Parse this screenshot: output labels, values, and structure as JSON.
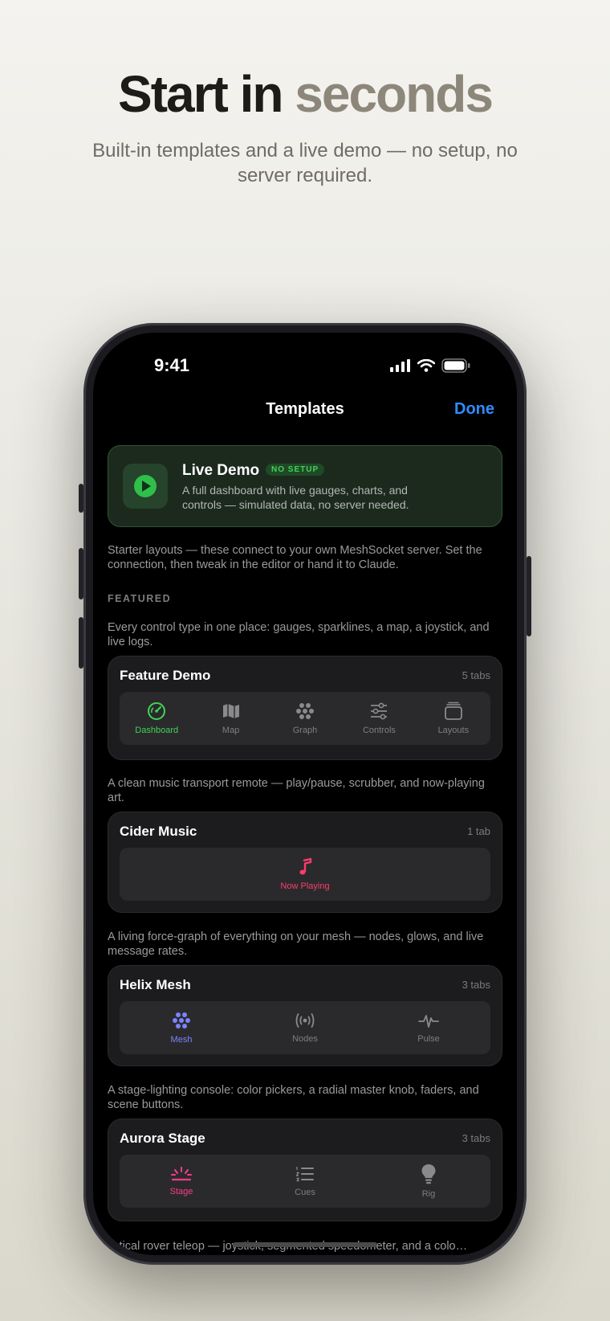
{
  "hero": {
    "title_main": "Start in",
    "title_accent": "seconds",
    "subtitle": "Built-in templates and a live demo — no setup, no server required."
  },
  "status_bar": {
    "time": "9:41"
  },
  "nav": {
    "title": "Templates",
    "done_label": "Done"
  },
  "live_demo": {
    "title": "Live Demo",
    "badge": "NO SETUP",
    "description": "A full dashboard with live gauges, charts, and controls — simulated data, no server needed."
  },
  "intro": "Starter layouts — these connect to your own MeshSocket server. Set the connection, then tweak in the editor or hand it to Claude.",
  "section_label": "FEATURED",
  "templates": [
    {
      "description": "Every control type in one place: gauges, sparklines, a map, a joystick, and live logs.",
      "name": "Feature Demo",
      "count": "5 tabs",
      "tabs": [
        {
          "label": "Dashboard",
          "icon": "gauge-icon",
          "active": true
        },
        {
          "label": "Map",
          "icon": "map-icon"
        },
        {
          "label": "Graph",
          "icon": "graph-icon"
        },
        {
          "label": "Controls",
          "icon": "sliders-icon"
        },
        {
          "label": "Layouts",
          "icon": "layers-icon"
        }
      ]
    },
    {
      "description": "A clean music transport remote — play/pause, scrubber, and now-playing art.",
      "name": "Cider Music",
      "count": "1 tab",
      "tabs": [
        {
          "label": "Now Playing",
          "icon": "music-note-icon",
          "active": true
        }
      ]
    },
    {
      "description": "A living force-graph of everything on your mesh — nodes, glows, and live message rates.",
      "name": "Helix Mesh",
      "count": "3 tabs",
      "tabs": [
        {
          "label": "Mesh",
          "icon": "mesh-icon",
          "active": true
        },
        {
          "label": "Nodes",
          "icon": "broadcast-icon"
        },
        {
          "label": "Pulse",
          "icon": "pulse-icon"
        }
      ]
    },
    {
      "description": "A stage-lighting console: color pickers, a radial master knob, faders, and scene buttons.",
      "name": "Aurora Stage",
      "count": "3 tabs",
      "tabs": [
        {
          "label": "Stage",
          "icon": "spotlight-icon",
          "active": true
        },
        {
          "label": "Cues",
          "icon": "list-icon"
        },
        {
          "label": "Rig",
          "icon": "bulb-icon"
        }
      ]
    }
  ],
  "partial_text": "…tical rover teleop — joystick, segmented speedometer, and a colo…",
  "colors": {
    "done": "#2f8cff",
    "demo_green": "#43d159",
    "feature_active": "#43d159",
    "music_active": "#ff3b6e",
    "mesh_active": "#7b83ff",
    "stage_active": "#ff3b8b"
  }
}
